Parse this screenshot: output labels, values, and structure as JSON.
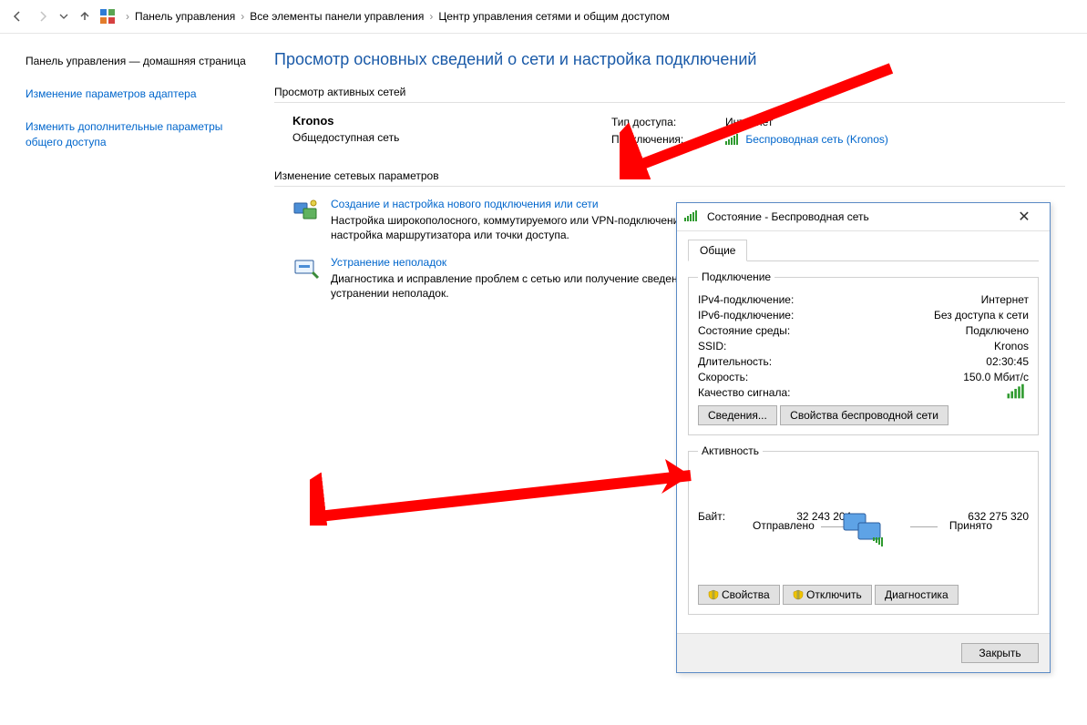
{
  "breadcrumb": {
    "items": [
      "Панель управления",
      "Все элементы панели управления",
      "Центр управления сетями и общим доступом"
    ]
  },
  "sidebar": {
    "home": "Панель управления — домашняя страница",
    "adapter": "Изменение параметров адаптера",
    "sharing": "Изменить дополнительные параметры общего доступа"
  },
  "main": {
    "title": "Просмотр основных сведений о сети и настройка подключений",
    "active_label": "Просмотр активных сетей",
    "change_label": "Изменение сетевых параметров",
    "network": {
      "name": "Kronos",
      "type": "Общедоступная сеть",
      "access_label": "Тип доступа:",
      "access_value": "Интернет",
      "conn_label": "Подключения:",
      "conn_value": "Беспроводная сеть (Kronos)"
    },
    "opt1": {
      "title": "Создание и настройка нового подключения или сети",
      "desc": "Настройка широкополосного, коммутируемого или VPN-подключения либо настройка маршрутизатора или точки доступа."
    },
    "opt2": {
      "title": "Устранение неполадок",
      "desc": "Диагностика и исправление проблем с сетью или получение сведений об устранении неполадок."
    }
  },
  "dialog": {
    "title": "Состояние - Беспроводная сеть",
    "tab": "Общие",
    "group_conn": "Подключение",
    "group_act": "Активность",
    "rows": {
      "ipv4_k": "IPv4-подключение:",
      "ipv4_v": "Интернет",
      "ipv6_k": "IPv6-подключение:",
      "ipv6_v": "Без доступа к сети",
      "media_k": "Состояние среды:",
      "media_v": "Подключено",
      "ssid_k": "SSID:",
      "ssid_v": "Kronos",
      "dur_k": "Длительность:",
      "dur_v": "02:30:45",
      "speed_k": "Скорость:",
      "speed_v": "150.0 Мбит/с",
      "signal_k": "Качество сигнала:"
    },
    "btn_details": "Сведения...",
    "btn_wprops": "Свойства беспроводной сети",
    "act_sent": "Отправлено",
    "act_recv": "Принято",
    "bytes_label": "Байт:",
    "bytes_sent": "32 243 204",
    "bytes_recv": "632 275 320",
    "btn_props": "Свойства",
    "btn_disc": "Отключить",
    "btn_diag": "Диагностика",
    "btn_close": "Закрыть"
  }
}
